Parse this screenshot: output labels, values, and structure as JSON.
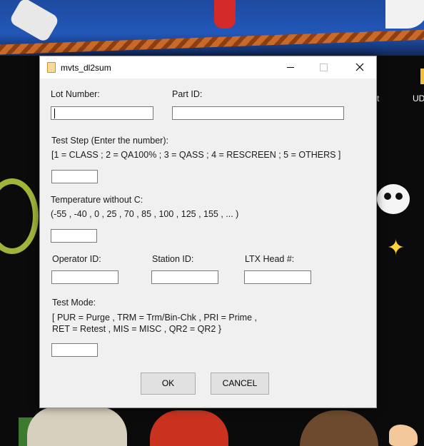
{
  "window": {
    "title": "mvts_dl2sum",
    "controls": {
      "minimize_icon": "minimize-icon",
      "maximize_icon": "maximize-icon",
      "close_icon": "close-icon"
    }
  },
  "desktop": {
    "partial_labels": [
      "t",
      "UD"
    ]
  },
  "form": {
    "lot_number": {
      "label": "Lot Number:",
      "value": ""
    },
    "part_id": {
      "label": "Part ID:",
      "value": ""
    },
    "test_step": {
      "label": "Test Step (Enter the number):",
      "hint": "[1 = CLASS ; 2 = QA100% ; 3 = QASS ; 4 = RESCREEN ; 5 = OTHERS ]",
      "value": ""
    },
    "temperature": {
      "label": "Temperature without C:",
      "hint": "(-55 , -40 , 0 , 25 , 70 , 85 , 100 , 125 , 155 , ... )",
      "value": ""
    },
    "operator_id": {
      "label": "Operator ID:",
      "value": ""
    },
    "station_id": {
      "label": "Station ID:",
      "value": ""
    },
    "ltx_head": {
      "label": "LTX Head #:",
      "value": ""
    },
    "test_mode": {
      "label": "Test Mode:",
      "hint_line1": "[ PUR = Purge , TRM = Trm/Bin-Chk , PRI = Prime ,",
      "hint_line2": "RET = Retest , MIS = MISC , QR2 = QR2 }",
      "value": ""
    }
  },
  "buttons": {
    "ok": "OK",
    "cancel": "CANCEL"
  }
}
